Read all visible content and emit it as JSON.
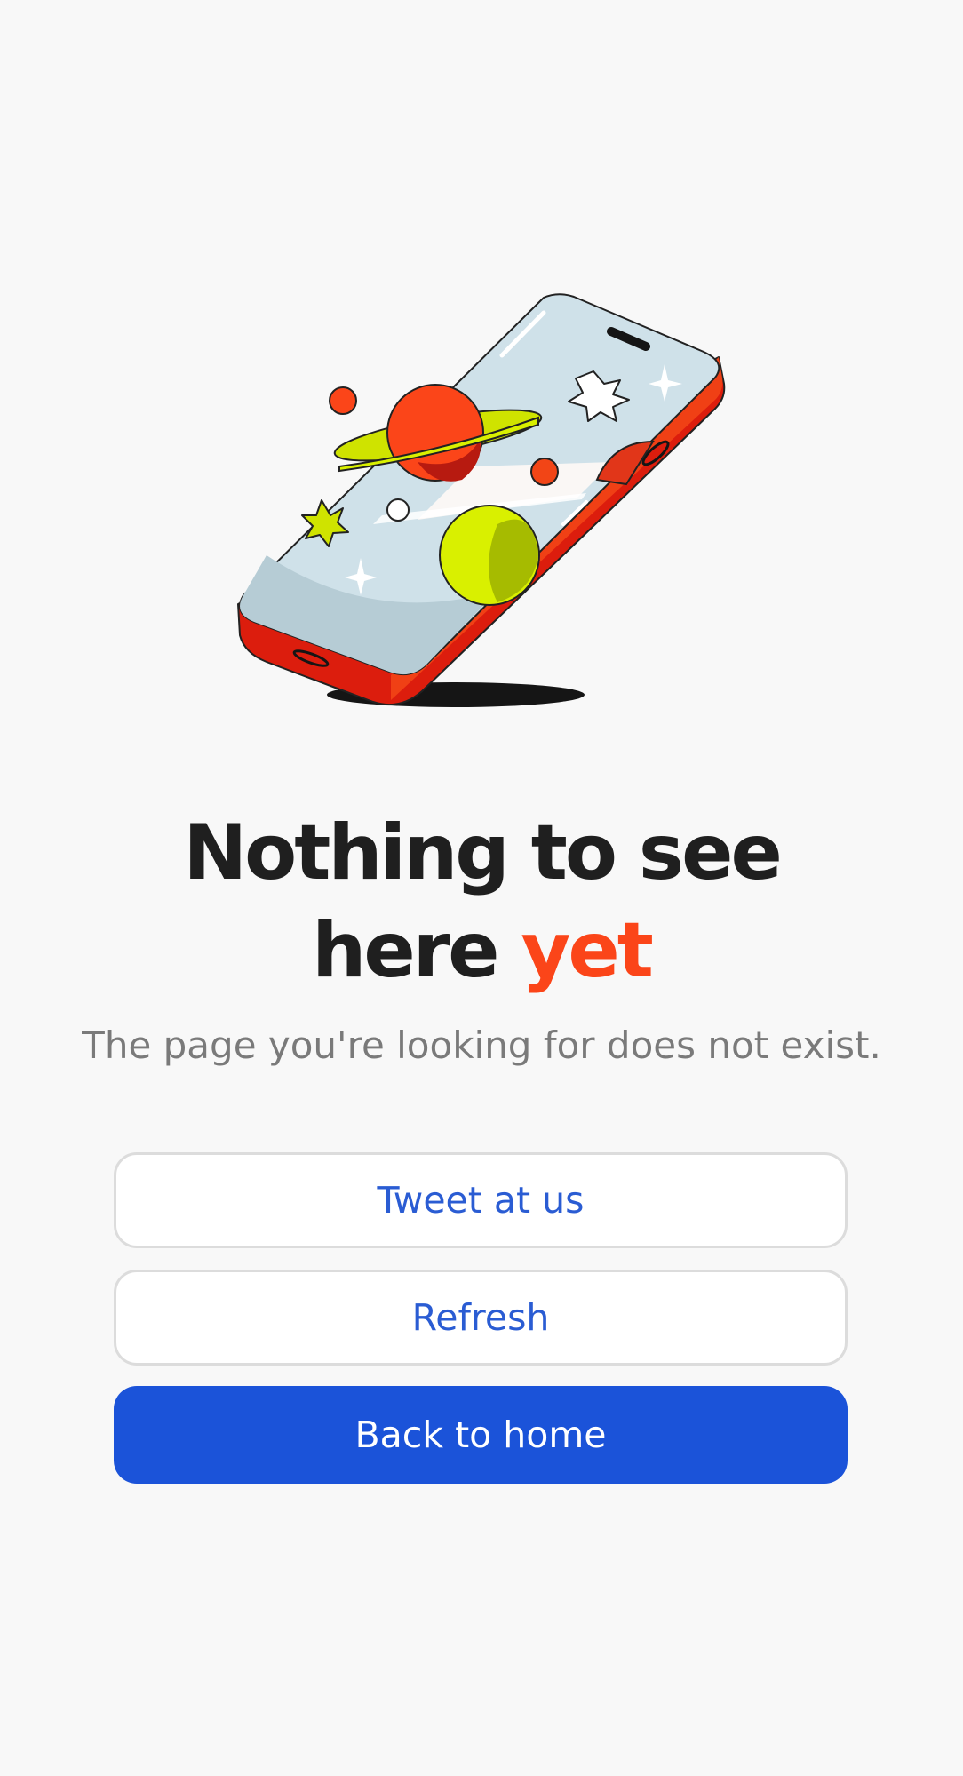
{
  "headline": {
    "line1": "Nothing to see",
    "line2_main": "here",
    "line2_accent": "yet"
  },
  "subtitle": "The page you're looking for does not exist.",
  "buttons": {
    "tweet": "Tweet at us",
    "refresh": "Refresh",
    "home": "Back to home"
  },
  "colors": {
    "background": "#f8f8f8",
    "accent": "#fb4519",
    "primary": "#1b53d9",
    "link": "#2a5cd3",
    "heading": "#1f1f1f",
    "muted": "#7a7a7a"
  },
  "illustration": {
    "icon": "phone-with-planets-illustration"
  }
}
